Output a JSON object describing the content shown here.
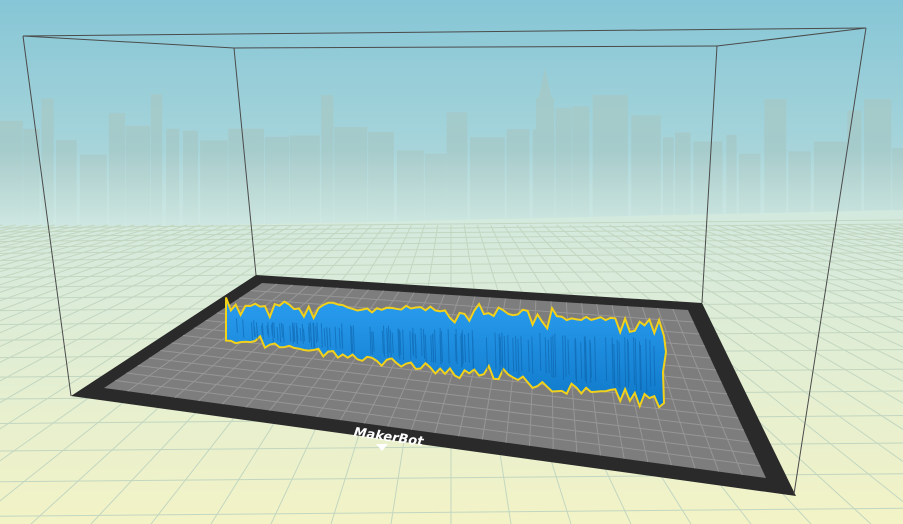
{
  "app": {
    "brand_label": "MakerBot"
  },
  "colors": {
    "sky_top": "#86c6d6",
    "sky_horizon": "#d4ebe4",
    "floor_far": "#d9ecdc",
    "floor_near": "#f1f2c8",
    "floor_grid": "#c2d6c0",
    "plate_frame": "#2a2a2a",
    "plate_surface": "#7d7d7d",
    "plate_grid": "#969696",
    "model_fill": "#1e8fe0",
    "model_outline": "#f2d11a",
    "build_volume_lines": "#4b4b4b",
    "skyline": "#a6c8c6"
  },
  "icons": {
    "brand_pointer": "triangle-down-icon"
  }
}
